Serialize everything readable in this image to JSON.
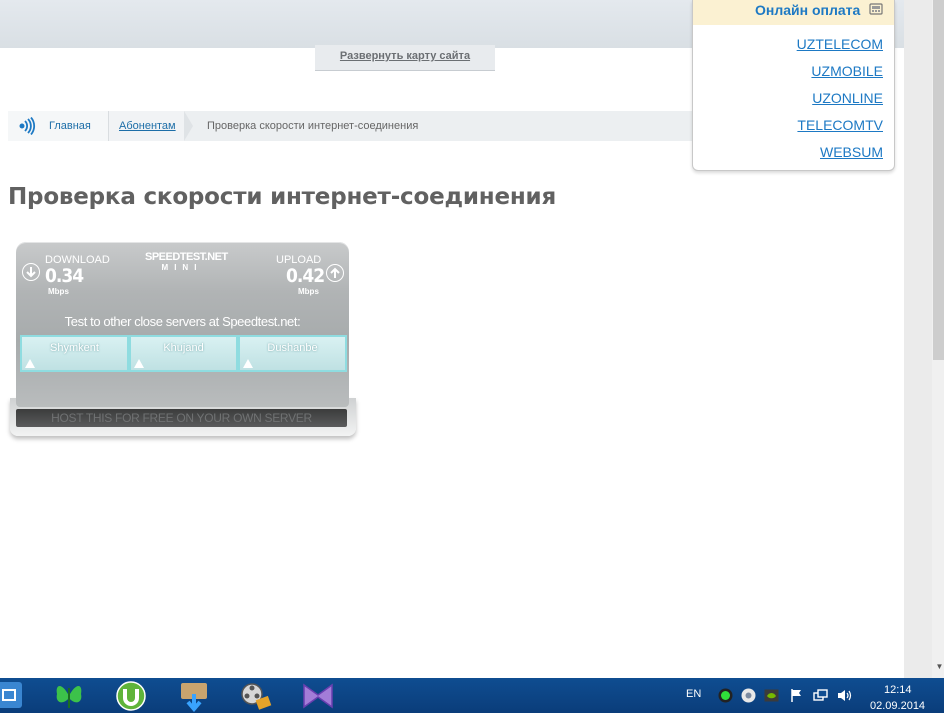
{
  "header": {
    "sitemap_toggle": "Развернуть карту сайта"
  },
  "online_payment": {
    "title": "Онлайн оплата",
    "links": [
      "UZTELECOM",
      "UZMOBILE",
      "UZONLINE",
      "TELECOMTV",
      "WEBSUM"
    ]
  },
  "breadcrumb": {
    "home": "Главная",
    "section": "Абонентам",
    "current": "Проверка скорости интернет-соединения"
  },
  "page": {
    "title": "Проверка скорости интернет-соединения"
  },
  "speedtest": {
    "brand": "SPEEDTEST.NET",
    "brand_sub": "MINI",
    "download": {
      "label": "DOWNLOAD",
      "value": "0.34",
      "unit": "Mbps"
    },
    "upload": {
      "label": "UPLOAD",
      "value": "0.42",
      "unit": "Mbps"
    },
    "prompt": "Test to other close servers at Speedtest.net:",
    "servers": [
      "Shymkent",
      "Khujand",
      "Dushanbe"
    ],
    "host_banner": "HOST THIS FOR FREE ON YOUR OWN SERVER"
  },
  "taskbar": {
    "language": "EN",
    "time": "12:14",
    "date": "02.09.2014"
  },
  "colors": {
    "link_blue": "#1d79c4",
    "title_grey": "#616161",
    "taskbar_blue": "#0f4d91",
    "payment_header_bg": "#fbf1d2"
  }
}
